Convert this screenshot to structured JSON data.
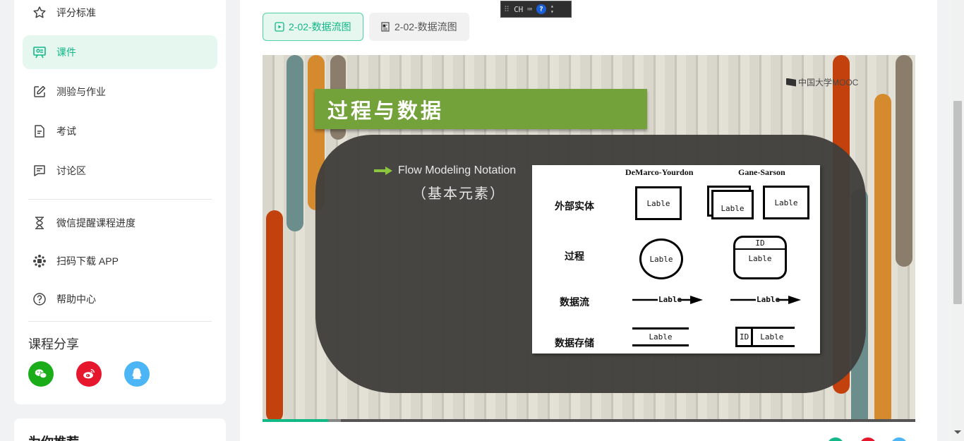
{
  "sidebar": {
    "items": [
      {
        "label": "评分标准",
        "icon": "star-icon"
      },
      {
        "label": "课件",
        "icon": "courseware-icon",
        "active": true
      },
      {
        "label": "测验与作业",
        "icon": "edit-icon"
      },
      {
        "label": "考试",
        "icon": "document-icon"
      },
      {
        "label": "讨论区",
        "icon": "chat-icon"
      }
    ],
    "tools": [
      {
        "label": "微信提醒课程进度",
        "icon": "hourglass-icon"
      },
      {
        "label": "扫码下载 APP",
        "icon": "app-icon"
      },
      {
        "label": "帮助中心",
        "icon": "help-icon"
      }
    ],
    "share_title": "课程分享",
    "share_colors": {
      "wechat": "#1aad19",
      "weibo": "#e6162d",
      "qq": "#4cb5f5"
    },
    "recommend_title": "为你推荐"
  },
  "tabs": [
    {
      "label": "2-02-数据流图",
      "type": "video",
      "active": true
    },
    {
      "label": "2-02-数据流图",
      "type": "document",
      "active": false
    }
  ],
  "ime": {
    "label": "CH",
    "help": "?"
  },
  "slide": {
    "title": "过程与数据",
    "watermark": "中国大学MOOC",
    "heading": "Flow Modeling Notation",
    "subheading": "（基本元素）",
    "columns": [
      "DeMarco-Yourdon",
      "Gane-Sarson"
    ],
    "rows": [
      "外部实体",
      "过程",
      "数据流",
      "数据存储"
    ],
    "box_label": "Lable",
    "id_label": "ID"
  },
  "player": {
    "progress": 0.1,
    "buffered": 0.12
  },
  "accent": "#12b886"
}
